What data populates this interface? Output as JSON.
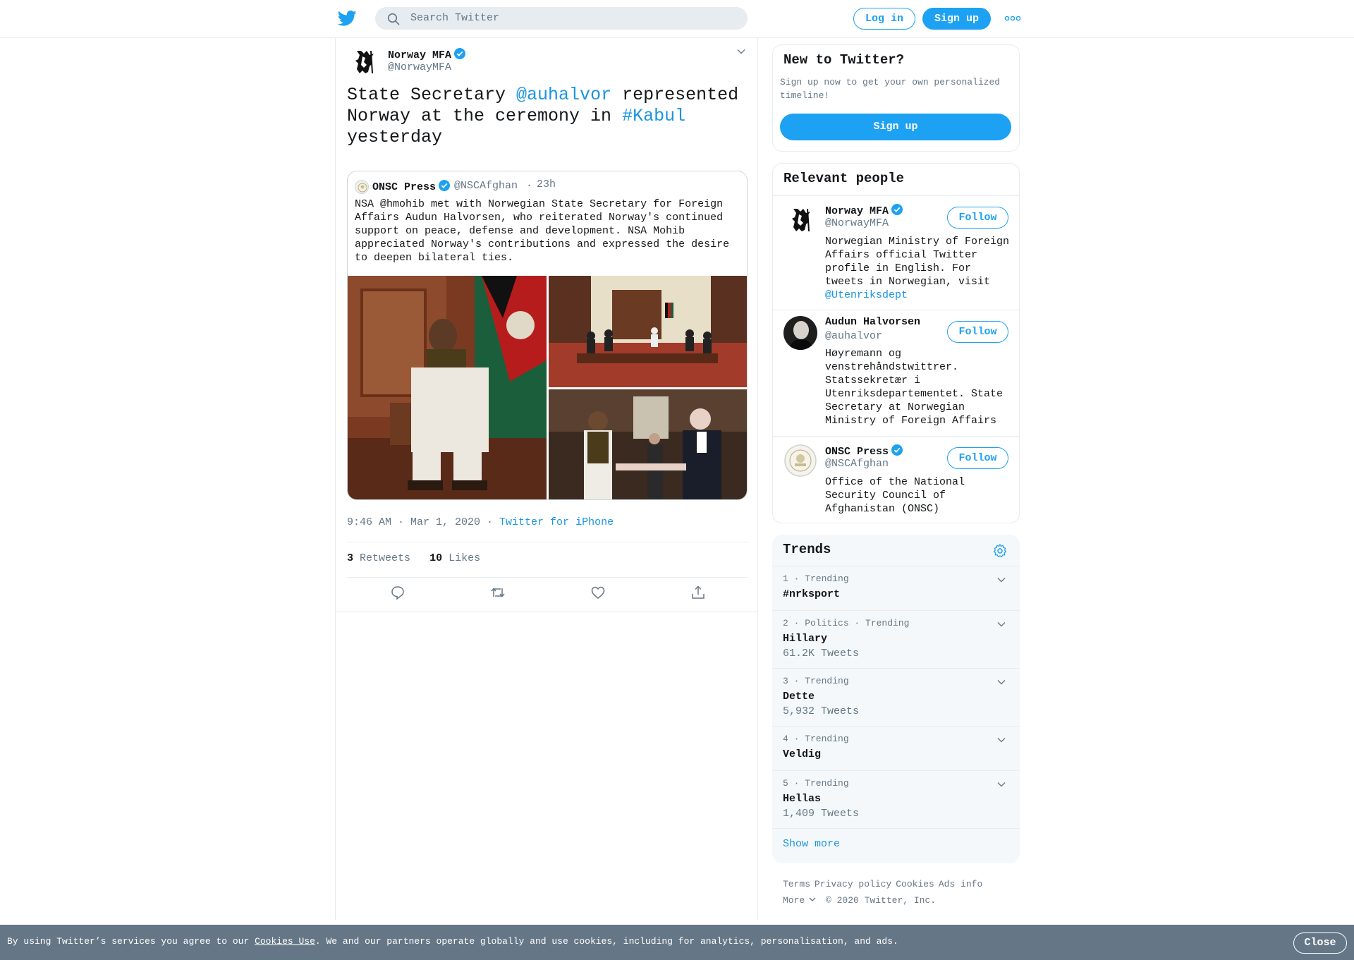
{
  "topbar": {
    "search_placeholder": "Search Twitter",
    "login_label": "Log in",
    "signup_label": "Sign up"
  },
  "tweet": {
    "author_name": "Norway MFA",
    "author_handle": "@NorwayMFA",
    "text_before": "State Secretary ",
    "mention": "@auhalvor",
    "text_middle": " represented Norway at the ceremony in ",
    "hashtag": "#Kabul",
    "text_after": " yesterday",
    "timestamp": "9:46 AM · Mar 1, 2020",
    "dot": " · ",
    "via": "Twitter for iPhone",
    "retweets_count": "3",
    "retweets_label": "Retweets",
    "likes_count": "10",
    "likes_label": "Likes"
  },
  "quote": {
    "author_name": "ONSC Press",
    "author_handle": "@NSCAfghan",
    "dot": "·",
    "time": "23h",
    "text": "NSA @hmohib met with Norwegian State Secretary for Foreign Affairs Audun Halvorsen, who reiterated Norway's continued support on peace, defense and development. NSA Mohib appreciated Norway's contributions and expressed the desire to deepen bilateral ties."
  },
  "new_to_twitter": {
    "title": "New to Twitter?",
    "description": "Sign up now to get your own personalized timeline!",
    "signup_label": "Sign up"
  },
  "relevant_people": {
    "title": "Relevant people",
    "follow_label": "Follow",
    "people": [
      {
        "name": "Norway MFA",
        "handle": "@NorwayMFA",
        "bio": "Norwegian Ministry of Foreign Affairs official Twitter profile in English. For tweets in Norwegian, visit ",
        "bio_link": "@Utenriksdept"
      },
      {
        "name": "Audun Halvorsen",
        "handle": "@auhalvor",
        "bio": "Høyremann og venstrehåndstwittrer. Statssekretær i Utenriksdepartementet. State Secretary at Norwegian Ministry of Foreign Affairs"
      },
      {
        "name": "ONSC Press",
        "handle": "@NSCAfghan",
        "bio": "Office of the National Security Council of Afghanistan (ONSC)"
      }
    ]
  },
  "trends": {
    "title": "Trends",
    "items": [
      {
        "meta": "1 · Trending",
        "name": "#nrksport",
        "count": ""
      },
      {
        "meta": "2 · Politics · Trending",
        "name": "Hillary",
        "count": "61.2K Tweets"
      },
      {
        "meta": "3 · Trending",
        "name": "Dette",
        "count": "5,932 Tweets"
      },
      {
        "meta": "4 · Trending",
        "name": "Veldig",
        "count": ""
      },
      {
        "meta": "5 · Trending",
        "name": "Hellas",
        "count": "1,409 Tweets"
      }
    ],
    "show_more": "Show more"
  },
  "footer": {
    "terms": "Terms",
    "privacy": "Privacy policy",
    "cookies": "Cookies",
    "ads": "Ads info",
    "more": "More",
    "copyright": "© 2020 Twitter, Inc."
  },
  "cookie_bar": {
    "text_before": "By using Twitter’s services you agree to our ",
    "link": "Cookies Use",
    "text_after": ". We and our partners operate globally and use cookies, including for analytics, personalisation, and ads.",
    "close_label": "Close"
  },
  "colors": {
    "brand": "#1da1f2",
    "link": "#1b95e0",
    "secondary_text": "#657786",
    "border": "#e6ecf0",
    "cookie_bar": "#657786"
  }
}
